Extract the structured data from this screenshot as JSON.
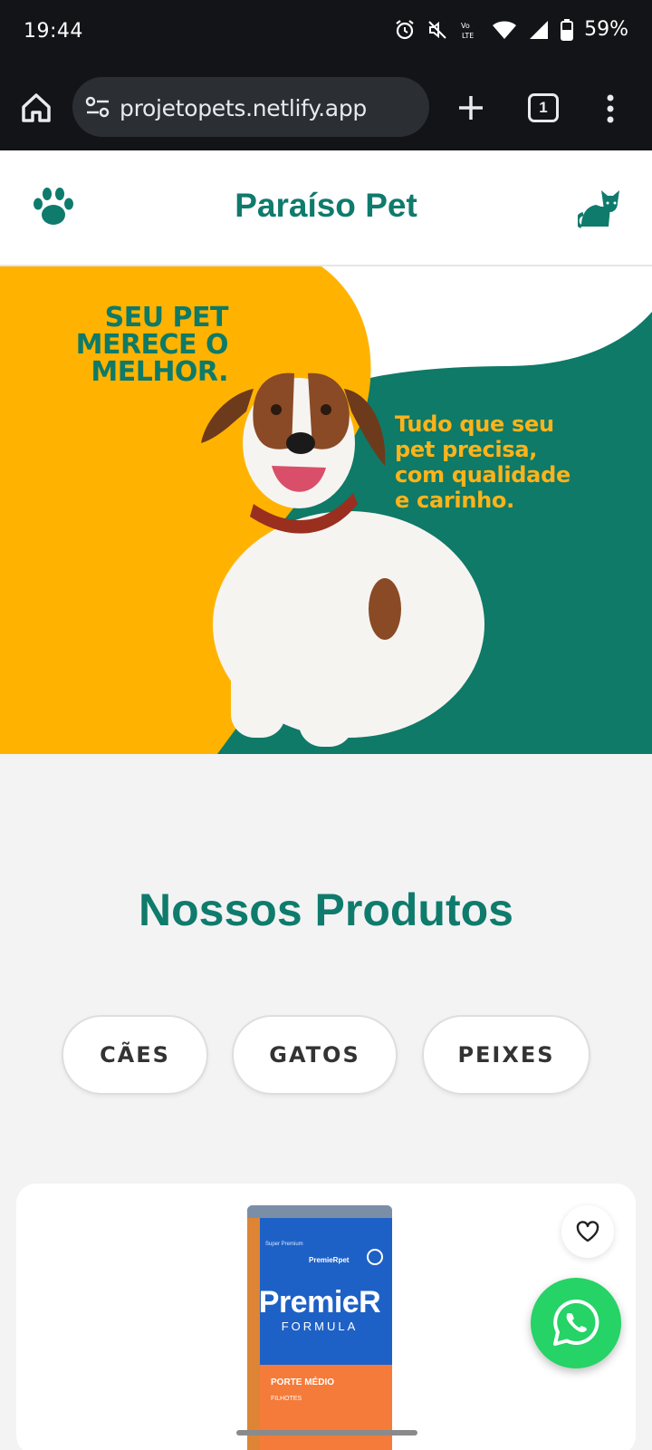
{
  "status_bar": {
    "time": "19:44",
    "battery": "59%",
    "icons": [
      "alarm-icon",
      "mute-icon",
      "volte-icon",
      "wifi-icon",
      "signal-icon",
      "battery-icon"
    ]
  },
  "browser": {
    "url": "projetopets.netlify.app",
    "tab_count": "1"
  },
  "header": {
    "title": "Paraíso Pet",
    "left_icon": "paw-icon",
    "right_icon": "cat-icon"
  },
  "hero": {
    "headline": "SEU PET\nMERECE O\nMELHOR.",
    "subtext": "Tudo que seu\npet precisa,\ncom qualidade\ne carinho."
  },
  "products": {
    "title": "Nossos Produtos",
    "categories": [
      "CÃES",
      "GATOS",
      "PEIXES"
    ],
    "first_product": {
      "brand": "PremieR",
      "line": "FORMULA",
      "small_tag": "Super Premium",
      "small_brand": "PremieRpet",
      "size": "PORTE MÉDIO",
      "age": "FILHOTES"
    }
  },
  "colors": {
    "brand_green": "#0f7b6c",
    "hero_yellow": "#ffb300",
    "whatsapp_green": "#25d366"
  }
}
